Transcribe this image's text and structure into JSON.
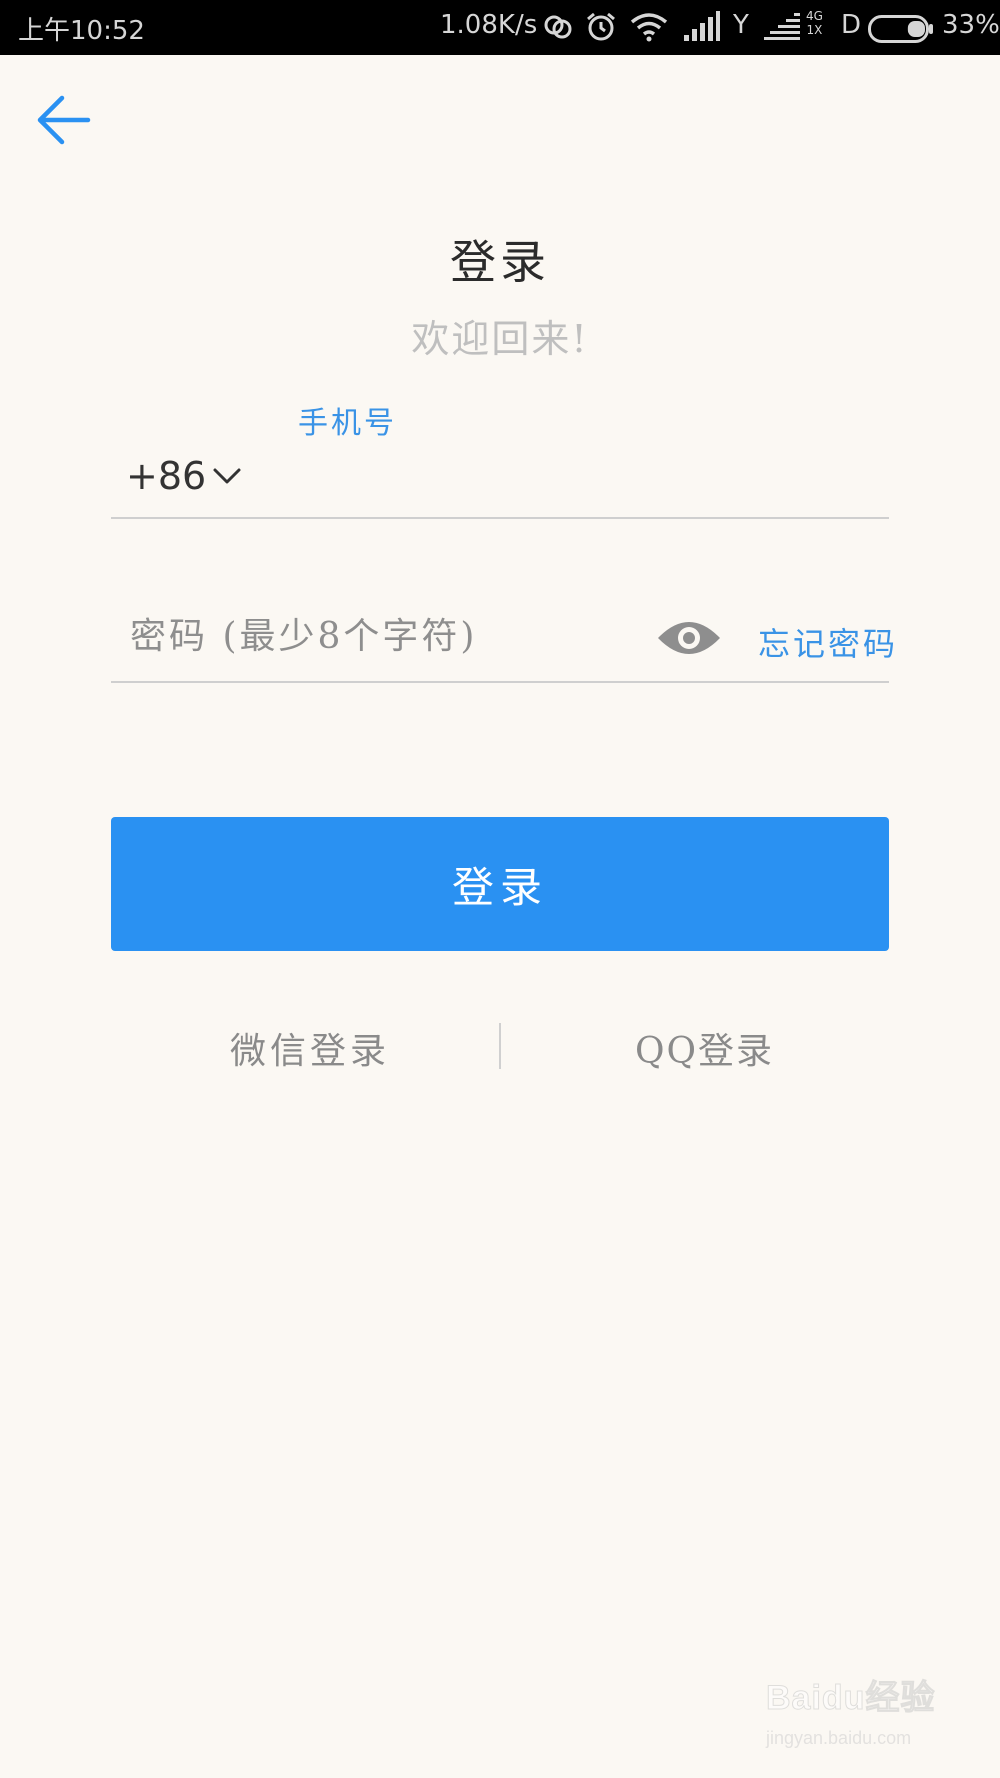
{
  "status_bar": {
    "time": "上午10:52",
    "net_speed": "1.08K/s",
    "sim1_label": "Y",
    "network_type_top": "4G",
    "network_type_bottom": "1X",
    "sim2_label": "D",
    "battery_percent": "33%",
    "battery_level": 0.33
  },
  "header": {
    "title": "登录",
    "subtitle": "欢迎回来!"
  },
  "phone": {
    "label": "手机号",
    "country_code": "+86",
    "value": ""
  },
  "password": {
    "placeholder": "密码 (最少8个字符)",
    "value": "",
    "forgot_label": "忘记密码"
  },
  "login_button": {
    "label": "登录"
  },
  "third_party": {
    "wechat_label": "微信登录",
    "qq_label": "QQ登录"
  },
  "watermark": {
    "brand": "Baidu经验",
    "url": "jingyan.baidu.com"
  },
  "colors": {
    "accent": "#2a91f2",
    "link": "#3a93e6",
    "background": "#fbf8f3"
  }
}
